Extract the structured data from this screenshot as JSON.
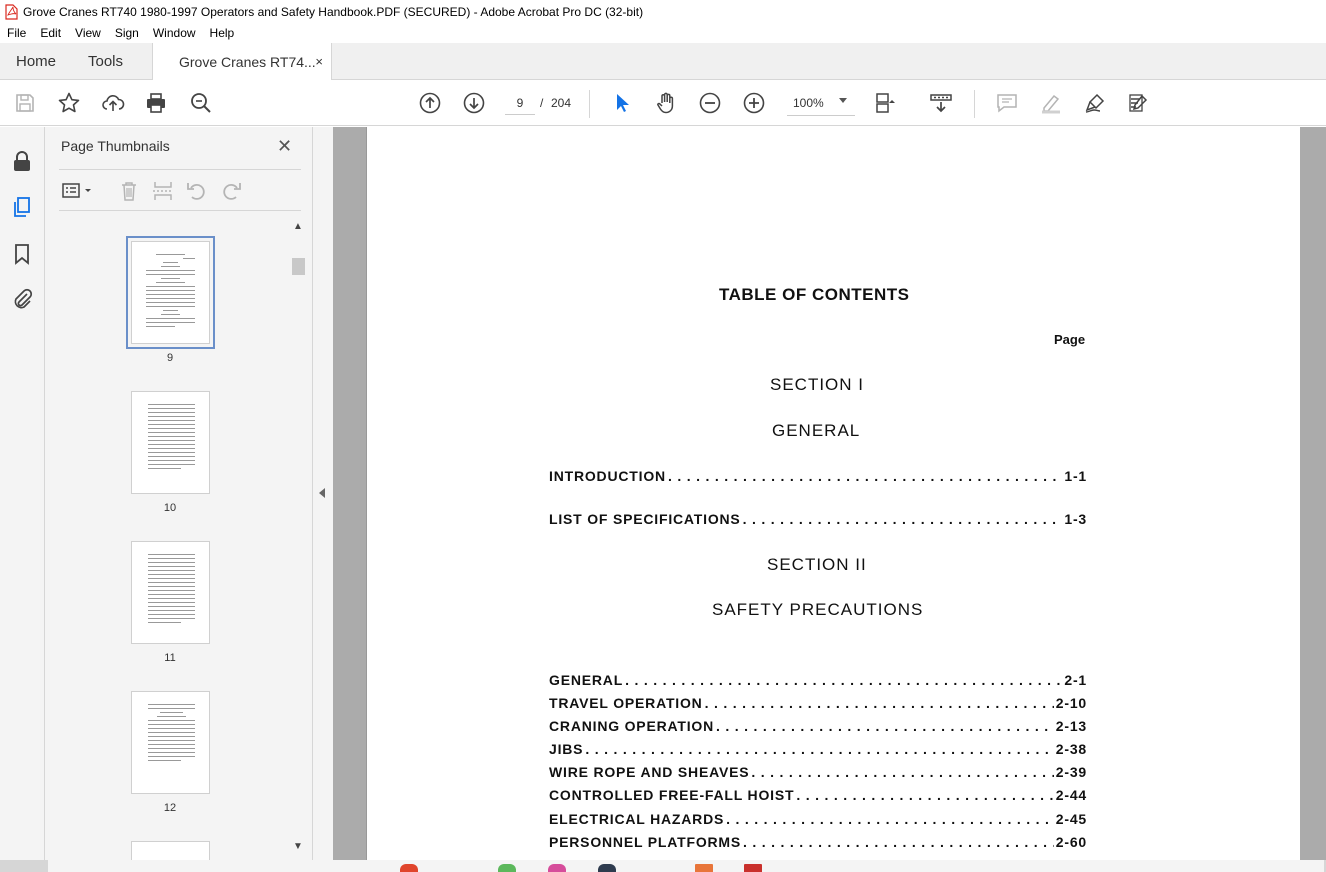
{
  "window": {
    "title": "Grove Cranes RT740 1980-1997 Operators and Safety Handbook.PDF (SECURED) - Adobe Acrobat Pro DC (32-bit)"
  },
  "menu": {
    "items": [
      "File",
      "Edit",
      "View",
      "Sign",
      "Window",
      "Help"
    ]
  },
  "tabs": {
    "home": "Home",
    "tools": "Tools",
    "document": "Grove Cranes RT74...",
    "close_glyph": "×"
  },
  "toolbar": {
    "current_page": "9",
    "page_separator": "/",
    "total_pages": "204",
    "zoom": "100%"
  },
  "panel": {
    "title": "Page Thumbnails",
    "close_glyph": "✕",
    "thumbnails": [
      {
        "label": "9",
        "selected": true
      },
      {
        "label": "10",
        "selected": false
      },
      {
        "label": "11",
        "selected": false
      },
      {
        "label": "12",
        "selected": false
      }
    ]
  },
  "document": {
    "toc_title": "TABLE OF CONTENTS",
    "page_label": "Page",
    "section1": "SECTION I",
    "section1_name": "GENERAL",
    "section1_entries": [
      {
        "label": "INTRODUCTION",
        "page": "1-1"
      },
      {
        "label": "LIST OF SPECIFICATIONS",
        "page": "1-3"
      }
    ],
    "section2": "SECTION II",
    "section2_name": "SAFETY PRECAUTIONS",
    "section2_entries": [
      {
        "label": "GENERAL",
        "page": "2-1"
      },
      {
        "label": "TRAVEL OPERATION",
        "page": "2-10"
      },
      {
        "label": "CRANING OPERATION",
        "page": "2-13"
      },
      {
        "label": "JIBS",
        "page": "2-38"
      },
      {
        "label": "WIRE ROPE AND SHEAVES",
        "page": "2-39"
      },
      {
        "label": "CONTROLLED FREE-FALL HOIST",
        "page": "2-44"
      },
      {
        "label": "ELECTRICAL HAZARDS",
        "page": "2-45"
      },
      {
        "label": "PERSONNEL PLATFORMS",
        "page": "2-60"
      }
    ]
  },
  "colors": {
    "accent_blue": "#1473e6",
    "pdf_red": "#d9281e",
    "icon_gray": "#444444",
    "disabled_gray": "#b4b4b4"
  },
  "icons": {
    "rail": [
      "lock-icon",
      "page-thumbnails-icon",
      "bookmark-icon",
      "attachment-icon"
    ],
    "toolbar": [
      "save-icon",
      "star-icon",
      "upload-icon",
      "print-icon",
      "search-zoom-icon",
      "prev-page-icon",
      "next-page-icon",
      "select-arrow-icon",
      "hand-icon",
      "zoom-out-icon",
      "zoom-in-icon",
      "page-display-icon",
      "scroll-mode-icon",
      "comment-icon",
      "highlight-icon",
      "draw-icon",
      "fill-sign-icon"
    ]
  }
}
